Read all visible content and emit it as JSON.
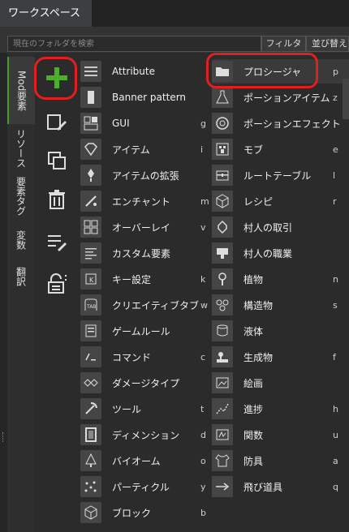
{
  "tabs": {
    "active": "ワークスペース"
  },
  "search": {
    "placeholder": "現在のフォルダを検索",
    "filter_label": "フィルタ",
    "sort_label": "並び替え"
  },
  "vertical_tabs": [
    "Mod要素",
    "リソース",
    "要素タグ",
    "変数",
    "翻訳"
  ],
  "tools": [
    "add",
    "edit",
    "duplicate",
    "delete",
    "list-edit",
    "lock"
  ],
  "menu": {
    "col1": [
      {
        "label": "Attribute",
        "key": ""
      },
      {
        "label": "Banner pattern",
        "key": ""
      },
      {
        "label": "GUI",
        "key": "g"
      },
      {
        "label": "アイテム",
        "key": "i"
      },
      {
        "label": "アイテムの拡張",
        "key": ""
      },
      {
        "label": "エンチャント",
        "key": "m"
      },
      {
        "label": "オーバーレイ",
        "key": "v"
      },
      {
        "label": "カスタム要素",
        "key": ""
      },
      {
        "label": "キー設定",
        "key": "k"
      },
      {
        "label": "クリエイティブタブ",
        "key": "w"
      },
      {
        "label": "ゲームルール",
        "key": ""
      },
      {
        "label": "コマンド",
        "key": "c"
      },
      {
        "label": "ダメージタイプ",
        "key": ""
      },
      {
        "label": "ツール",
        "key": "t"
      },
      {
        "label": "ディメンション",
        "key": "d"
      },
      {
        "label": "バイオーム",
        "key": "o"
      },
      {
        "label": "パーティクル",
        "key": "y"
      },
      {
        "label": "ブロック",
        "key": "b"
      }
    ],
    "col2": [
      {
        "label": "プロシージャ",
        "key": "p"
      },
      {
        "label": "ポーションアイテム",
        "key": "z"
      },
      {
        "label": "ポーションエフェクト",
        "key": ""
      },
      {
        "label": "モブ",
        "key": "e"
      },
      {
        "label": "ルートテーブル",
        "key": "l"
      },
      {
        "label": "レシピ",
        "key": "r"
      },
      {
        "label": "村人の取引",
        "key": ""
      },
      {
        "label": "村人の職業",
        "key": ""
      },
      {
        "label": "植物",
        "key": "n"
      },
      {
        "label": "構造物",
        "key": "s"
      },
      {
        "label": "液体",
        "key": ""
      },
      {
        "label": "生成物",
        "key": "f"
      },
      {
        "label": "絵画",
        "key": ""
      },
      {
        "label": "進捗",
        "key": "h"
      },
      {
        "label": "関数",
        "key": "u"
      },
      {
        "label": "防具",
        "key": "a"
      },
      {
        "label": "飛び道具",
        "key": "q"
      }
    ]
  },
  "colors": {
    "accent_green": "#4c9a2a",
    "highlight_red": "#e02020"
  }
}
